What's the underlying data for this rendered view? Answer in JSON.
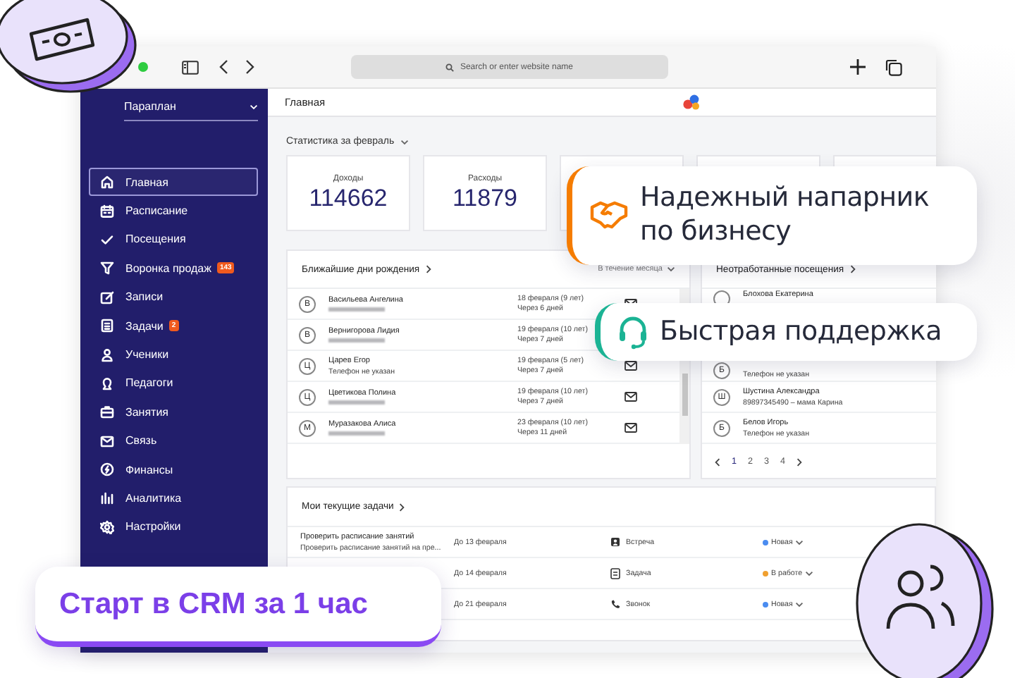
{
  "browser": {
    "address_placeholder": "Search or enter website name"
  },
  "sidebar": {
    "org": "Параплан",
    "items": [
      {
        "label": "Главная",
        "selected": true
      },
      {
        "label": "Расписание",
        "selected": false
      },
      {
        "label": "Посещения",
        "selected": false
      },
      {
        "label": "Воронка продаж",
        "selected": false,
        "badge": "143"
      },
      {
        "label": "Записи",
        "selected": false
      },
      {
        "label": "Задачи",
        "selected": false,
        "badge": "2"
      },
      {
        "label": "Ученики",
        "selected": false
      },
      {
        "label": "Педагоги",
        "selected": false
      },
      {
        "label": "Занятия",
        "selected": false
      },
      {
        "label": "Связь",
        "selected": false
      },
      {
        "label": "Финансы",
        "selected": false
      },
      {
        "label": "Аналитика",
        "selected": false
      },
      {
        "label": "Настройки",
        "selected": false
      }
    ]
  },
  "header": {
    "title": "Главная"
  },
  "stats": {
    "title": "Статистика за февраль",
    "cards": [
      {
        "label": "Доходы",
        "value": "114662"
      },
      {
        "label": "Расходы",
        "value": "11879"
      }
    ]
  },
  "birthdays": {
    "title": "Ближайшие дни рождения",
    "filter": "В течение месяца",
    "rows": [
      {
        "avatar": "В",
        "name": "Васильева Ангелина",
        "phone_blurred": true,
        "date": "18 февраля (9 лет)",
        "when": "Через 6 дней"
      },
      {
        "avatar": "В",
        "name": "Вернигорова Лидия",
        "phone_blurred": true,
        "date": "19 февраля (10 лет)",
        "when": "Через 7 дней"
      },
      {
        "avatar": "Ц",
        "name": "Царев Егор",
        "phone_blurred": false,
        "phone": "Телефон не указан",
        "date": "19 февраля (5 лет)",
        "when": "Через 7 дней"
      },
      {
        "avatar": "Ц",
        "name": "Цветикова Полина",
        "phone_blurred": true,
        "date": "19 февраля (10 лет)",
        "when": "Через 7 дней"
      },
      {
        "avatar": "М",
        "name": "Муразакова Алиса",
        "phone_blurred": true,
        "date": "23 февраля (10 лет)",
        "when": "Через 11 дней"
      }
    ]
  },
  "visits": {
    "title": "Неотработанные посещения",
    "rows": [
      {
        "name": "Блохова Екатерина"
      },
      {
        "avatar": "Б",
        "phone": "Телефон не указан"
      },
      {
        "avatar": "Ш",
        "name": "Шустина Александра",
        "phone": "89897345490 – мама Карина"
      },
      {
        "avatar": "Б",
        "name": "Белов Игорь",
        "phone": "Телефон не указан"
      }
    ],
    "pages": [
      {
        "label": "1",
        "selected": true
      },
      {
        "label": "2",
        "selected": false
      },
      {
        "label": "3",
        "selected": false
      },
      {
        "label": "4",
        "selected": false
      }
    ]
  },
  "tasks": {
    "title": "Мои текущие задачи",
    "rows": [
      {
        "title": "Проверить расписание занятий",
        "subtitle": "Проверить расписание занятий на пре...",
        "due": "До 13 февраля",
        "kind": "meeting",
        "type": "Встреча",
        "status": "Новая",
        "color": "#4a8cf0"
      },
      {
        "due": "До 14 февраля",
        "kind": "task",
        "type": "Задача",
        "status": "В работе",
        "color": "#f0a030"
      },
      {
        "due": "До 21 февраля",
        "kind": "call",
        "type": "Звонок",
        "status": "Новая",
        "color": "#4a8cf0"
      }
    ]
  },
  "promos": [
    {
      "kind": "partner",
      "text": "Надежный напарник по бизнесу"
    },
    {
      "kind": "support",
      "text": "Быстрая поддержка"
    }
  ],
  "cta": {
    "text": "Старт в CRM за 1 час"
  }
}
